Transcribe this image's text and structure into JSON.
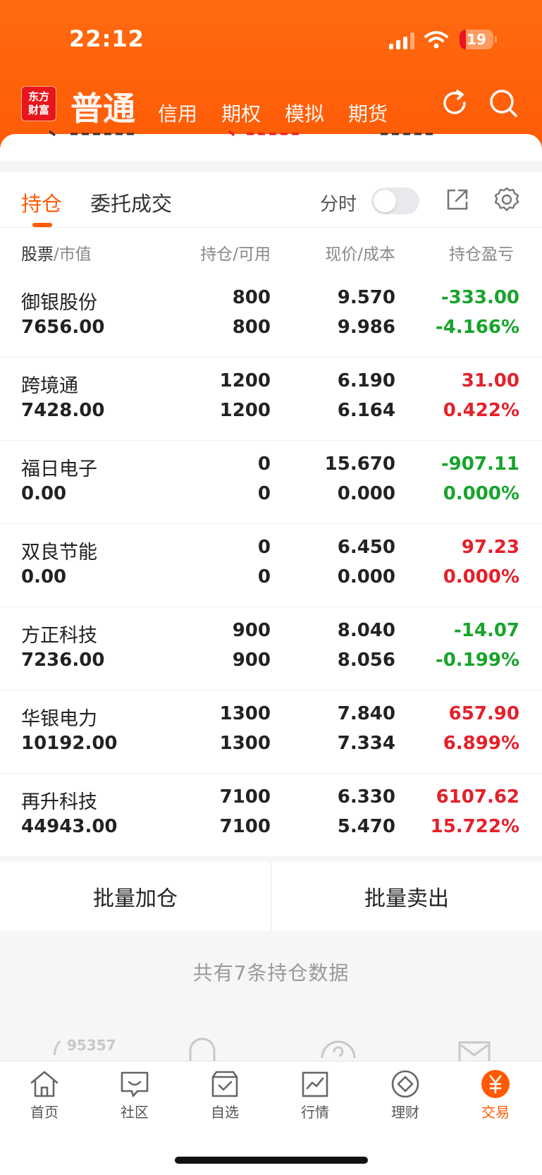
{
  "status_bar": {
    "time": "22:12",
    "battery": "19"
  },
  "header": {
    "logo_line1": "东方",
    "logo_line2": "财富",
    "tabs": [
      {
        "label": "普通",
        "active": true
      },
      {
        "label": "信用"
      },
      {
        "label": "期权"
      },
      {
        "label": "模拟"
      },
      {
        "label": "期货"
      }
    ],
    "icons": [
      "refresh-icon",
      "search-icon"
    ]
  },
  "subtabs": {
    "positions": "持仓",
    "orders": "委托成交",
    "fenshi_label": "分时",
    "fenshi_on": false
  },
  "table": {
    "headers": {
      "stock": "股票",
      "mv": "市值",
      "hold": "持仓",
      "avail": "可用",
      "price": "现价",
      "cost": "成本",
      "pnl": "持仓盈亏"
    },
    "rows": [
      {
        "name": "御银股份",
        "mv": "7656.00",
        "hold": "800",
        "avail": "800",
        "price": "9.570",
        "cost": "9.986",
        "pnl": "-333.00",
        "pnl_pct": "-4.166%",
        "dir": "down"
      },
      {
        "name": "跨境通",
        "mv": "7428.00",
        "hold": "1200",
        "avail": "1200",
        "price": "6.190",
        "cost": "6.164",
        "pnl": "31.00",
        "pnl_pct": "0.422%",
        "dir": "up"
      },
      {
        "name": "福日电子",
        "mv": "0.00",
        "hold": "0",
        "avail": "0",
        "price": "15.670",
        "cost": "0.000",
        "pnl": "-907.11",
        "pnl_pct": "0.000%",
        "dir": "down"
      },
      {
        "name": "双良节能",
        "mv": "0.00",
        "hold": "0",
        "avail": "0",
        "price": "6.450",
        "cost": "0.000",
        "pnl": "97.23",
        "pnl_pct": "0.000%",
        "dir": "up"
      },
      {
        "name": "方正科技",
        "mv": "7236.00",
        "hold": "900",
        "avail": "900",
        "price": "8.040",
        "cost": "8.056",
        "pnl": "-14.07",
        "pnl_pct": "-0.199%",
        "dir": "down"
      },
      {
        "name": "华银电力",
        "mv": "10192.00",
        "hold": "1300",
        "avail": "1300",
        "price": "7.840",
        "cost": "7.334",
        "pnl": "657.90",
        "pnl_pct": "6.899%",
        "dir": "up"
      },
      {
        "name": "再升科技",
        "mv": "44943.00",
        "hold": "7100",
        "avail": "7100",
        "price": "6.330",
        "cost": "5.470",
        "pnl": "6107.62",
        "pnl_pct": "15.722%",
        "dir": "up"
      }
    ]
  },
  "actions": {
    "batch_add": "批量加仓",
    "batch_sell": "批量卖出"
  },
  "summary": "共有7条持仓数据",
  "peek_number": "95357",
  "bottom_nav": [
    {
      "label": "首页",
      "icon": "home-icon"
    },
    {
      "label": "社区",
      "icon": "community-icon"
    },
    {
      "label": "自选",
      "icon": "watchlist-icon"
    },
    {
      "label": "行情",
      "icon": "market-icon"
    },
    {
      "label": "理财",
      "icon": "wealth-icon"
    },
    {
      "label": "交易",
      "icon": "trade-icon",
      "active": true
    }
  ],
  "colors": {
    "brand": "#ff5a05",
    "up": "#e5202a",
    "down": "#17a42b"
  }
}
